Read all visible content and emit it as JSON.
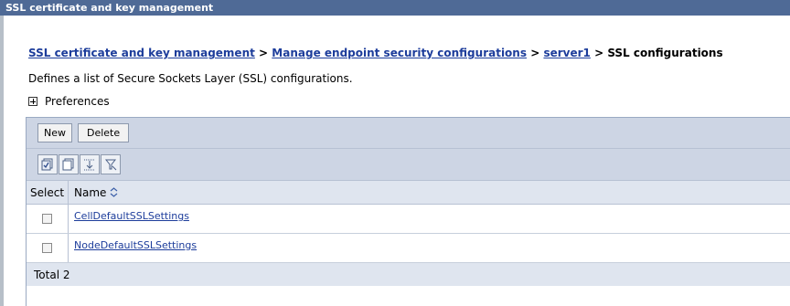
{
  "window": {
    "title": "SSL certificate and key management"
  },
  "breadcrumb": {
    "items": [
      "SSL certificate and key management",
      "Manage endpoint security configurations",
      "server1"
    ],
    "separator": ">",
    "current": "SSL configurations"
  },
  "description": "Defines a list of Secure Sockets Layer (SSL) configurations.",
  "preferences": {
    "label": "Preferences"
  },
  "toolbar": {
    "new_label": "New",
    "delete_label": "Delete"
  },
  "icons": [
    "select-all-icon",
    "deselect-all-icon",
    "show-filter-icon",
    "clear-filter-icon"
  ],
  "table": {
    "headers": {
      "select": "Select",
      "name": "Name"
    },
    "rows": [
      {
        "name": "CellDefaultSSLSettings"
      },
      {
        "name": "NodeDefaultSSLSettings"
      }
    ],
    "total": "Total 2"
  },
  "colors": {
    "title_bar": "#4f6a96",
    "link": "#1d3d9b",
    "toolbar_bg": "#cdd5e4",
    "header_bg": "#dfe5ef"
  }
}
